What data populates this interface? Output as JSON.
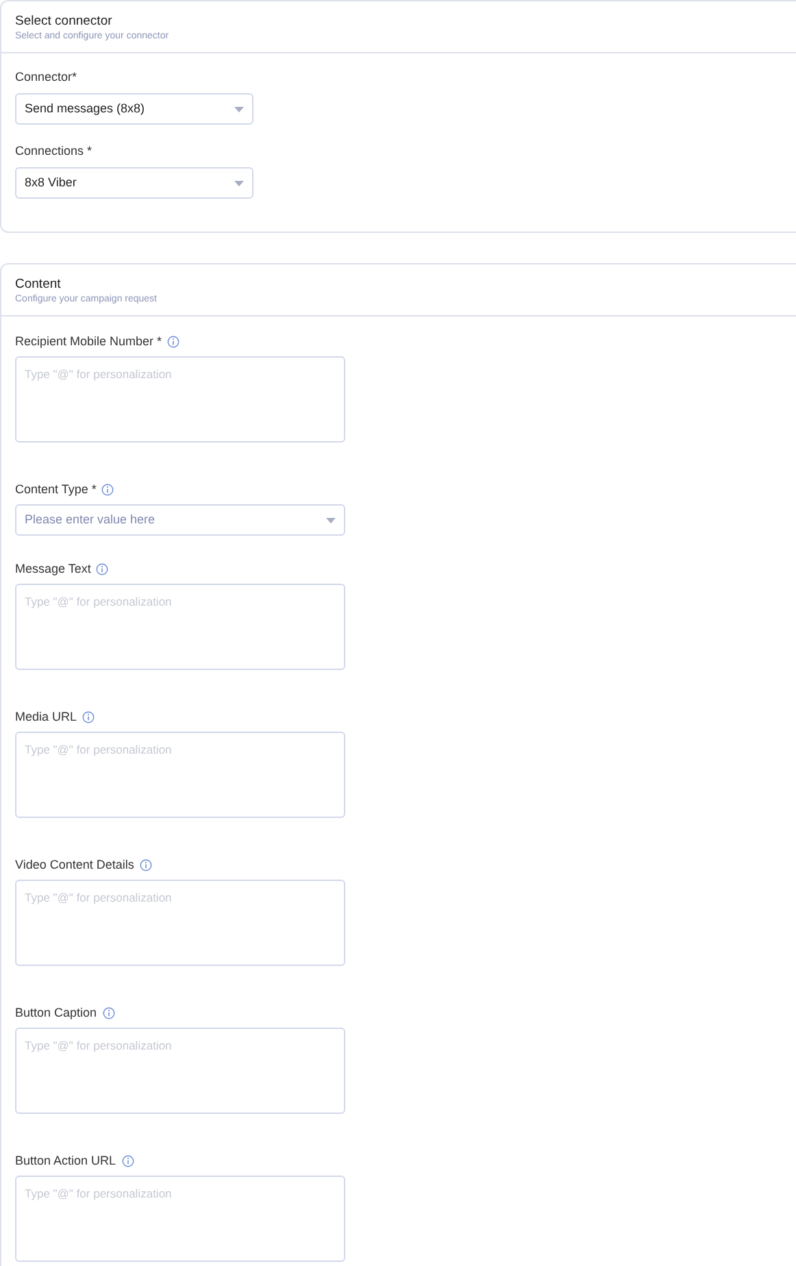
{
  "sections": [
    {
      "title": "Select connector",
      "subtitle": "Select and configure your connector",
      "fields": [
        {
          "kind": "select",
          "label": "Connector*",
          "value": "Send messages (8x8)",
          "info": false
        },
        {
          "kind": "select",
          "label": "Connections *",
          "value": "8x8 Viber",
          "info": false
        }
      ]
    },
    {
      "title": "Content",
      "subtitle": "Configure your campaign request",
      "fields": [
        {
          "kind": "textarea",
          "label": "Recipient Mobile Number *",
          "placeholder": "Type \"@\" for personalization",
          "info": true
        },
        {
          "kind": "select",
          "label": "Content Type *",
          "placeholder": "Please enter value here",
          "info": true
        },
        {
          "kind": "textarea",
          "label": "Message Text",
          "placeholder": "Type \"@\" for personalization",
          "info": true
        },
        {
          "kind": "textarea",
          "label": "Media URL",
          "placeholder": "Type \"@\" for personalization",
          "info": true
        },
        {
          "kind": "textarea",
          "label": "Video Content Details",
          "placeholder": "Type \"@\" for personalization",
          "info": true
        },
        {
          "kind": "textarea",
          "label": "Button Caption",
          "placeholder": "Type \"@\" for personalization",
          "info": true
        },
        {
          "kind": "textarea",
          "label": "Button Action URL",
          "placeholder": "Type \"@\" for personalization",
          "info": true
        }
      ]
    }
  ]
}
